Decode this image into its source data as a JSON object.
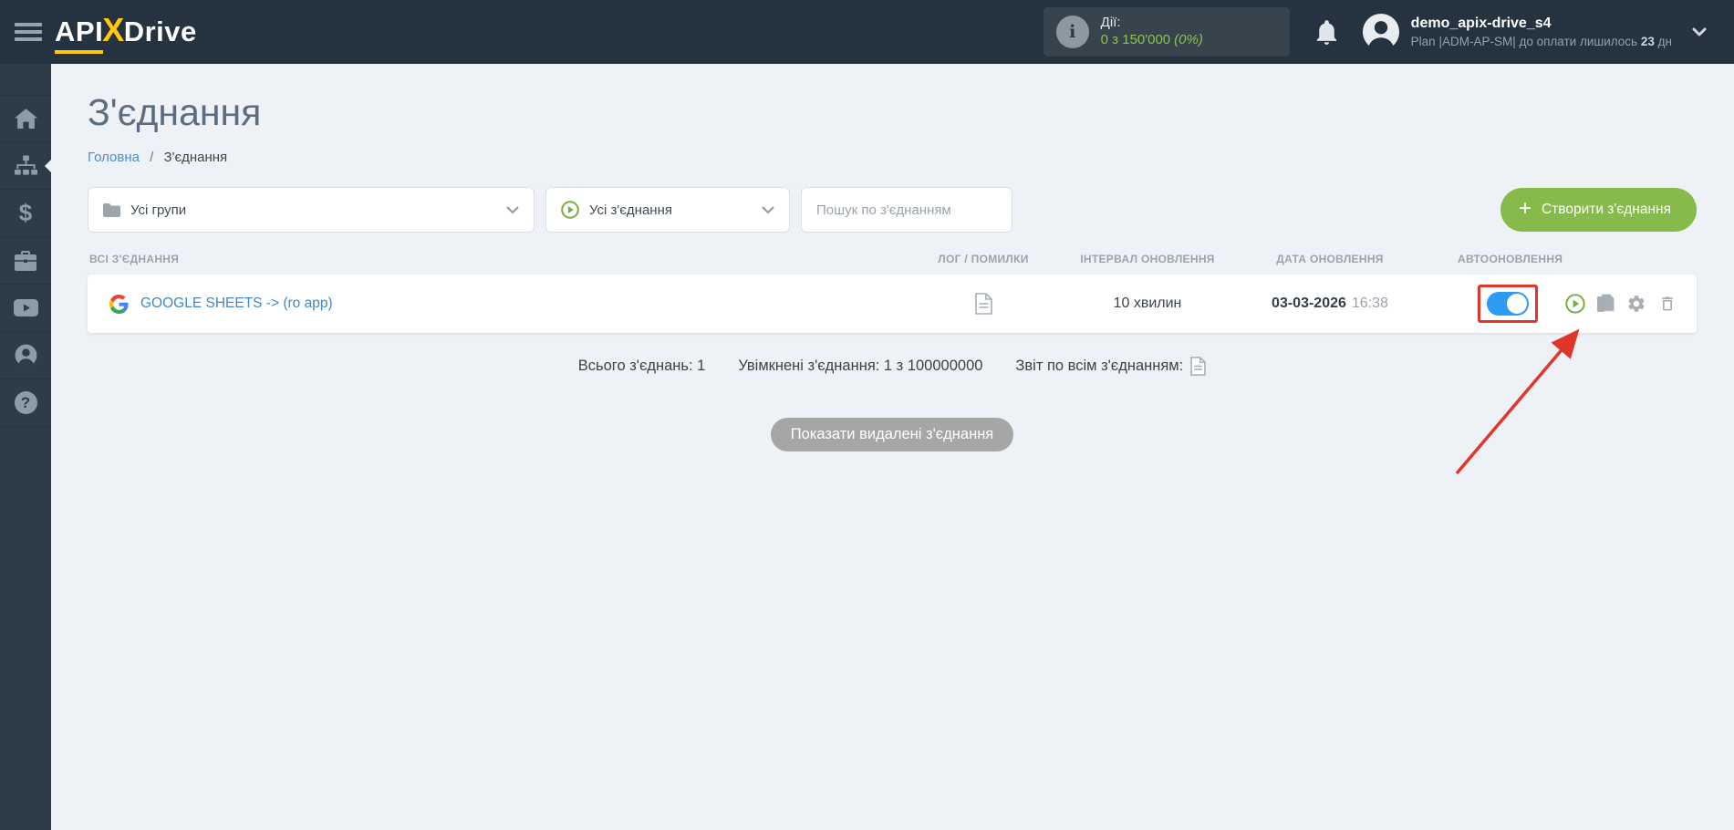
{
  "topbar": {
    "logo": {
      "part1": "API",
      "part2": "X",
      "part3": "Drive"
    },
    "actions": {
      "label": "Дії:",
      "count": "0 з 150'000",
      "percent": "(0%)"
    },
    "user": {
      "name": "demo_apix-drive_s4",
      "plan_prefix": "Plan |ADM-AP-SM| до оплати лишилось",
      "plan_days": "23",
      "plan_suffix": "дн"
    }
  },
  "sidebar": {
    "items": [
      "home",
      "connections",
      "billing",
      "services",
      "video",
      "account",
      "help"
    ]
  },
  "page": {
    "title": "З'єднання",
    "breadcrumb": {
      "home": "Головна",
      "separator": "/",
      "current": "З'єднання"
    }
  },
  "filters": {
    "groups": "Усі групи",
    "connections": "Усі з'єднання",
    "search_placeholder": "Пошук по з'єднанням",
    "create_plus": "+",
    "create_button": "Створити з'єднання"
  },
  "table": {
    "headers": [
      "ВСІ З'ЄДНАННЯ",
      "ЛОГ / ПОМИЛКИ",
      "ІНТЕРВАЛ ОНОВЛЕННЯ",
      "ДАТА ОНОВЛЕННЯ",
      "АВТООНОВЛЕННЯ"
    ],
    "row": {
      "name": "GOOGLE SHEETS -> (ro app)",
      "interval": "10 хвилин",
      "date": "03-03-2026",
      "time": "16:38",
      "auto_update_on": true
    }
  },
  "summary": {
    "total": "Всього з'єднань: 1",
    "enabled": "Увімкнені з'єднання: 1 з 100000000",
    "report": "Звіт по всім з'єднанням:"
  },
  "show_deleted_button": "Показати видалені з'єднання",
  "icons": {
    "dollar_glyph": "$",
    "question_glyph": "?",
    "info_glyph": "i"
  },
  "colors": {
    "topbar_bg": "#253240",
    "sidebar_bg": "#2e3c4a",
    "accent_green": "#86ba4a",
    "counter_green": "#8bc34a",
    "link_blue": "#4187c7",
    "toggle_blue": "#2d9bf3",
    "annotation_red": "#e0352b",
    "logo_yellow": "#ffc908",
    "page_bg": "#eef2f7"
  }
}
